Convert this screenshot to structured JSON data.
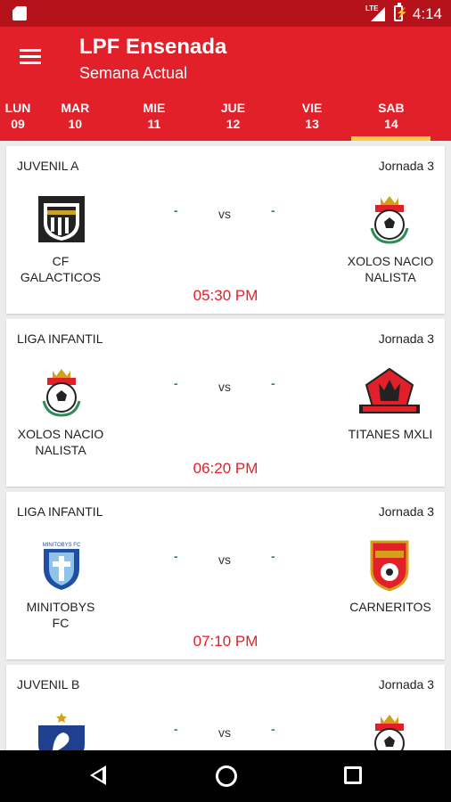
{
  "status_bar": {
    "time": "4:14",
    "network": "LTE"
  },
  "app_bar": {
    "title": "LPF Ensenada",
    "subtitle": "Semana Actual",
    "menu_icon": "hamburger-menu-icon"
  },
  "tabs": [
    {
      "day": "LUN",
      "date": "09"
    },
    {
      "day": "MAR",
      "date": "10"
    },
    {
      "day": "MIE",
      "date": "11"
    },
    {
      "day": "JUE",
      "date": "12"
    },
    {
      "day": "VIE",
      "date": "13"
    },
    {
      "day": "SAB",
      "date": "14",
      "selected": true
    }
  ],
  "colors": {
    "primary": "#e2202a",
    "status_bar": "#b5121b",
    "tab_indicator": "#f7c948",
    "time_text": "#e2202a",
    "score_dash": "#2e8b57"
  },
  "matches": [
    {
      "league": "JUVENIL A",
      "round": "Jornada 3",
      "home": {
        "name": "CF\nGALACTICOS",
        "logo": "galacticos-shield-icon"
      },
      "home_score": "-",
      "vs": "vs",
      "away_score": "-",
      "away": {
        "name": "XOLOS NACIO\nNALISTA",
        "logo": "xolos-crest-icon"
      },
      "time": "05:30 PM"
    },
    {
      "league": "LIGA INFANTIL",
      "round": "Jornada 3",
      "home": {
        "name": "XOLOS NACIO\nNALISTA",
        "logo": "xolos-crest-icon"
      },
      "home_score": "-",
      "vs": "vs",
      "away_score": "-",
      "away": {
        "name": "TITANES MXLI",
        "logo": "titanes-crest-icon"
      },
      "time": "06:20 PM"
    },
    {
      "league": "LIGA INFANTIL",
      "round": "Jornada 3",
      "home": {
        "name": "MINITOBYS\nFC",
        "logo": "minitobys-shield-icon"
      },
      "home_score": "-",
      "vs": "vs",
      "away_score": "-",
      "away": {
        "name": "CARNERITOS",
        "logo": "carneritos-shield-icon"
      },
      "time": "07:10 PM"
    },
    {
      "league": "JUVENIL B",
      "round": "Jornada 3",
      "home": {
        "name": "",
        "logo": "rooster-crest-icon"
      },
      "home_score": "-",
      "vs": "vs",
      "away_score": "-",
      "away": {
        "name": "",
        "logo": "xolos-crest-icon"
      },
      "time": ""
    }
  ]
}
